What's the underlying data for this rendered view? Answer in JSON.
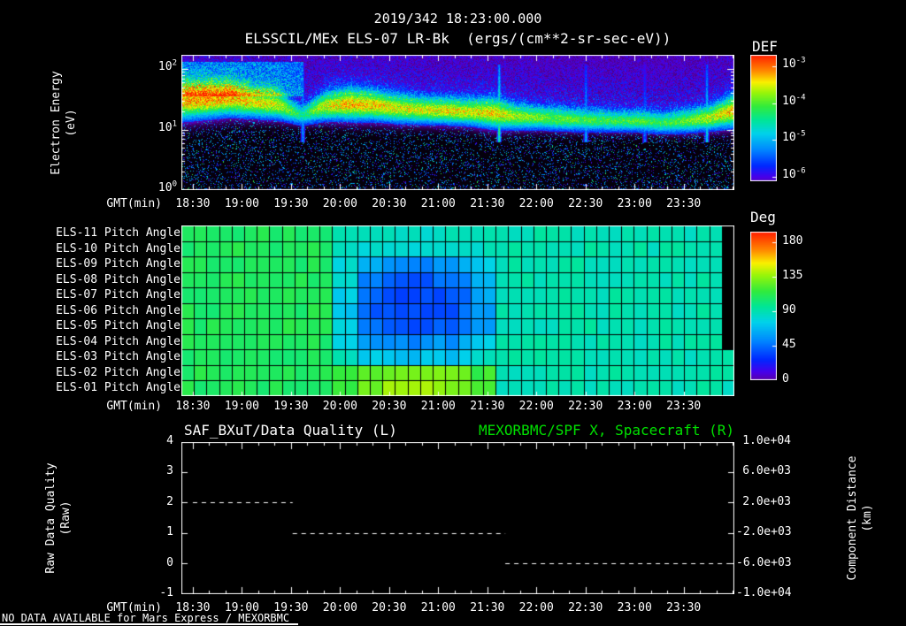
{
  "header": {
    "timestamp": "2019/342 18:23:00.000",
    "title": "ELSSCIL/MEx ELS-07 LR-Bk  (ergs/(cm**2-sr-sec-eV))"
  },
  "time_axis": {
    "label": "GMT(min)",
    "start_min": 1103,
    "end_min": 1441,
    "tick_minutes": [
      1110,
      1140,
      1170,
      1200,
      1230,
      1260,
      1290,
      1320,
      1350,
      1380,
      1410
    ],
    "tick_labels": [
      "18:30",
      "19:00",
      "19:30",
      "20:00",
      "20:30",
      "21:00",
      "21:30",
      "22:00",
      "22:30",
      "23:00",
      "23:30"
    ]
  },
  "chart_data": [
    {
      "id": "energy_spectrogram",
      "type": "heatmap",
      "title": "ELSSCIL/MEx ELS-07 LR-Bk",
      "units": "ergs/(cm**2-sr-sec-eV)",
      "ylabel_lines": [
        "Electron Energy",
        "(eV)"
      ],
      "yscale": "log",
      "ylim_log10": [
        0,
        2.23
      ],
      "yticks": [
        {
          "base": "10",
          "exp": "0",
          "log": 0
        },
        {
          "base": "10",
          "exp": "1",
          "log": 1
        },
        {
          "base": "10",
          "exp": "2",
          "log": 2
        }
      ],
      "colorbar": {
        "title": "DEF",
        "tick_labels": [
          {
            "base": "10",
            "exp": "-3"
          },
          {
            "base": "10",
            "exp": "-4"
          },
          {
            "base": "10",
            "exp": "-5"
          },
          {
            "base": "10",
            "exp": "-6"
          }
        ],
        "range_log10": [
          -3,
          -6
        ]
      },
      "band_profile_note": "24 control points evenly spaced from start_min to end_min; bright electron flux band center (log10 eV), relative intensity and width",
      "band_center_log10": [
        1.48,
        1.5,
        1.52,
        1.46,
        1.42,
        1.24,
        1.4,
        1.43,
        1.41,
        1.36,
        1.33,
        1.32,
        1.3,
        1.28,
        1.22,
        1.2,
        1.18,
        1.16,
        1.15,
        1.15,
        1.12,
        1.15,
        1.2,
        1.32
      ],
      "band_intensity": [
        0.95,
        1.0,
        0.95,
        0.85,
        0.8,
        0.4,
        0.82,
        0.95,
        0.9,
        0.82,
        0.8,
        0.85,
        0.8,
        0.9,
        0.7,
        0.62,
        0.6,
        0.55,
        0.52,
        0.56,
        0.5,
        0.6,
        0.75,
        0.95
      ],
      "band_width_log10": [
        0.2,
        0.19,
        0.18,
        0.16,
        0.15,
        0.1,
        0.15,
        0.17,
        0.16,
        0.15,
        0.14,
        0.14,
        0.14,
        0.16,
        0.13,
        0.12,
        0.12,
        0.11,
        0.11,
        0.11,
        0.11,
        0.12,
        0.13,
        0.17
      ],
      "streaks": [
        {
          "min": 1177,
          "intensity": 0.55
        },
        {
          "min": 1297,
          "intensity": 0.92
        },
        {
          "min": 1350,
          "intensity": 0.62
        },
        {
          "min": 1386,
          "intensity": 0.45
        },
        {
          "min": 1424,
          "intensity": 0.75
        }
      ]
    },
    {
      "id": "pitch_angle_grid",
      "type": "heatmap",
      "row_labels": [
        "ELS-11 Pitch Angle",
        "ELS-10 Pitch Angle",
        "ELS-09 Pitch Angle",
        "ELS-08 Pitch Angle",
        "ELS-07 Pitch Angle",
        "ELS-06 Pitch Angle",
        "ELS-05 Pitch Angle",
        "ELS-04 Pitch Angle",
        "ELS-03 Pitch Angle",
        "ELS-02 Pitch Angle",
        "ELS-01 Pitch Angle"
      ],
      "colorbar": {
        "title": "Deg",
        "ticks": [
          180,
          135,
          90,
          45,
          0
        ],
        "range": [
          0,
          180
        ]
      },
      "columns_note": "23 time columns evenly spanning start_min to end_min; values in degrees, null = no data (black)",
      "values_deg": [
        [
          105,
          105,
          105,
          105,
          105,
          105,
          88,
          85,
          85,
          85,
          85,
          85,
          86,
          88,
          88,
          88,
          88,
          88,
          88,
          88,
          88,
          88,
          null
        ],
        [
          105,
          105,
          105,
          105,
          105,
          105,
          86,
          80,
          78,
          78,
          80,
          82,
          85,
          88,
          88,
          88,
          88,
          88,
          88,
          88,
          88,
          88,
          null
        ],
        [
          105,
          105,
          105,
          105,
          105,
          105,
          82,
          64,
          58,
          56,
          58,
          64,
          74,
          88,
          88,
          88,
          88,
          88,
          88,
          88,
          88,
          88,
          null
        ],
        [
          105,
          105,
          105,
          105,
          105,
          105,
          78,
          52,
          46,
          44,
          46,
          52,
          66,
          88,
          88,
          88,
          88,
          88,
          88,
          88,
          88,
          88,
          null
        ],
        [
          105,
          105,
          105,
          105,
          105,
          105,
          75,
          46,
          40,
          38,
          42,
          48,
          62,
          88,
          88,
          88,
          88,
          88,
          88,
          88,
          88,
          88,
          null
        ],
        [
          105,
          105,
          105,
          105,
          105,
          105,
          74,
          44,
          40,
          38,
          42,
          48,
          60,
          88,
          88,
          88,
          88,
          88,
          88,
          88,
          88,
          88,
          null
        ],
        [
          105,
          105,
          105,
          105,
          105,
          105,
          76,
          48,
          44,
          42,
          46,
          52,
          62,
          88,
          88,
          88,
          88,
          88,
          88,
          88,
          88,
          88,
          null
        ],
        [
          105,
          105,
          105,
          105,
          105,
          105,
          80,
          60,
          56,
          55,
          58,
          62,
          72,
          88,
          88,
          88,
          88,
          88,
          88,
          88,
          88,
          88,
          null
        ],
        [
          105,
          105,
          105,
          105,
          105,
          105,
          86,
          74,
          71,
          70,
          72,
          76,
          82,
          88,
          88,
          88,
          88,
          88,
          88,
          88,
          88,
          88,
          88
        ],
        [
          105,
          105,
          105,
          105,
          105,
          105,
          108,
          120,
          124,
          126,
          124,
          120,
          112,
          88,
          88,
          88,
          88,
          88,
          88,
          88,
          88,
          88,
          88
        ],
        [
          105,
          105,
          105,
          105,
          105,
          105,
          110,
          124,
          128,
          130,
          128,
          124,
          114,
          88,
          88,
          88,
          88,
          88,
          88,
          88,
          88,
          88,
          88
        ]
      ]
    },
    {
      "id": "quality_distance",
      "type": "line",
      "title_left": "SAF_BXuT/Data Quality (L)",
      "title_right": "MEXORBMC/SPF X, Spacecraft (R)",
      "left_axis": {
        "label_lines": [
          "Raw Data Quality",
          "(Raw)"
        ],
        "ticks": [
          4,
          3,
          2,
          1,
          0,
          -1
        ],
        "lim": [
          -1,
          4
        ]
      },
      "right_axis": {
        "label_lines": [
          "Component Distance",
          "(km)"
        ],
        "ticks": [
          "1.0e+04",
          "6.0e+03",
          "2.0e+03",
          "-2.0e+03",
          "-6.0e+03",
          "-1.0e+04"
        ],
        "lim": [
          -10000,
          10000
        ]
      },
      "series": [
        {
          "name": "SAF_BXuT/Data Quality",
          "color": "#ffffff",
          "style": "dashed",
          "segments": [
            {
              "value": 2,
              "start_min": 1110,
              "end_min": 1171
            },
            {
              "value": 1,
              "start_min": 1171,
              "end_min": 1301
            },
            {
              "value": 0,
              "start_min": 1301,
              "end_min": 1440
            }
          ]
        },
        {
          "name": "MEXORBMC/SPF X, Spacecraft",
          "color": "#00e000",
          "points": [],
          "status": "NO DATA AVAILABLE"
        }
      ]
    }
  ],
  "footer": {
    "no_data_text": "NO DATA AVAILABLE for Mars Express / MEXORBMC"
  },
  "colors": {
    "background": "#000000",
    "axis": "#ffffff",
    "text": "#ffffff",
    "green_title": "#00e000"
  }
}
